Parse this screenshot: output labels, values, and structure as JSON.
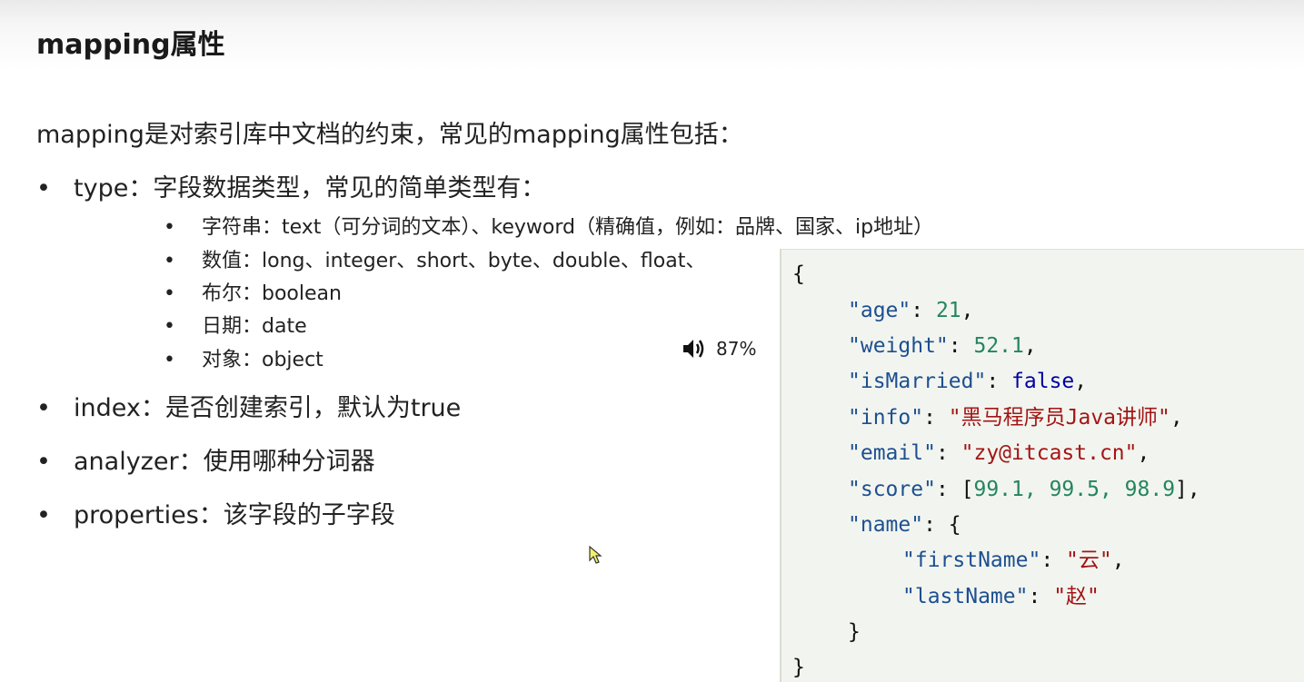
{
  "title": "mapping属性",
  "intro": "mapping是对索引库中文档的约束，常见的mapping属性包括：",
  "bullets": {
    "type": "type：字段数据类型，常见的简单类型有：",
    "index": "index：是否创建索引，默认为true",
    "analyzer": "analyzer：使用哪种分词器",
    "properties": "properties：该字段的子字段"
  },
  "sub_bullets": [
    "字符串：text（可分词的文本）、keyword（精确值，例如：品牌、国家、ip地址）",
    "数值：long、integer、short、byte、double、float、",
    "布尔：boolean",
    "日期：date",
    "对象：object"
  ],
  "bullet_glyph": "•",
  "volume": {
    "icon": "speaker-icon",
    "level": "87%"
  },
  "code": {
    "open_brace": "{",
    "close_brace": "}",
    "age_key": "\"age\"",
    "age_val": "21",
    "weight_key": "\"weight\"",
    "weight_val": "52.1",
    "isMarried_key": "\"isMarried\"",
    "isMarried_val": "false",
    "info_key": "\"info\"",
    "info_val": "\"黑马程序员Java讲师\"",
    "email_key": "\"email\"",
    "email_val": "\"zy@itcast.cn\"",
    "score_key": "\"score\"",
    "score_val": "99.1, 99.5, 98.9",
    "name_key": "\"name\"",
    "firstName_key": "\"firstName\"",
    "firstName_val": "\"云\"",
    "lastName_key": "\"lastName\"",
    "lastName_val": "\"赵\""
  },
  "colors": {
    "key": "#1d4f91",
    "number": "#25855e",
    "string": "#a31515",
    "boolean": "#0000a0",
    "code_background": "#f2f5ef"
  }
}
